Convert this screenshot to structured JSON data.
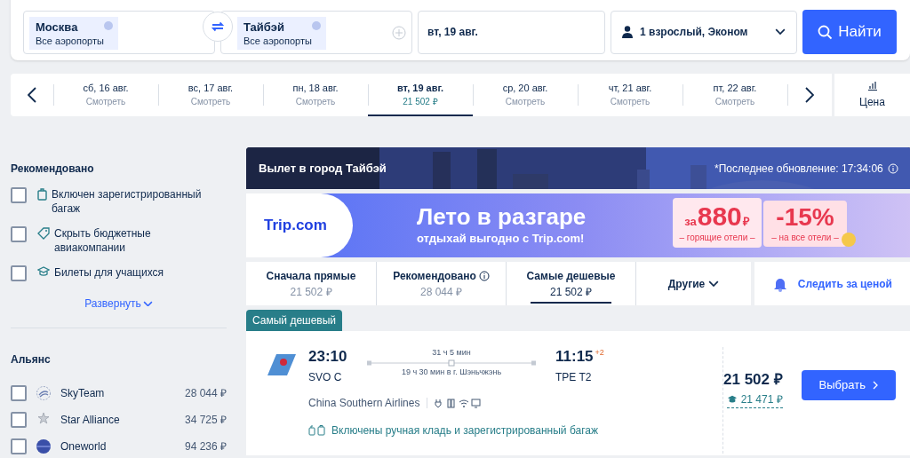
{
  "search": {
    "origin": {
      "city": "Москва",
      "airports": "Все аэропорты"
    },
    "destination": {
      "city": "Тайбэй",
      "airports": "Все аэропорты"
    },
    "date": "вт, 19 авг.",
    "passengers": "1 взрослый, Эконом",
    "button": "Найти"
  },
  "dates": [
    {
      "day": "сб, 16 авг.",
      "price": "Смотреть",
      "selected": false
    },
    {
      "day": "вс, 17 авг.",
      "price": "Смотреть",
      "selected": false
    },
    {
      "day": "пн, 18 авг.",
      "price": "Смотреть",
      "selected": false
    },
    {
      "day": "вт, 19 авг.",
      "price": "21 502 ₽",
      "selected": true
    },
    {
      "day": "ср, 20 авг.",
      "price": "Смотреть",
      "selected": false
    },
    {
      "day": "чт, 21 авг.",
      "price": "Смотреть",
      "selected": false
    },
    {
      "day": "пт, 22 авг.",
      "price": "Смотреть",
      "selected": false
    }
  ],
  "price_chart_button": "Цена",
  "sidebar": {
    "recommended": {
      "title": "Рекомендовано",
      "items": [
        {
          "kind": "baggage",
          "label": "Включен зарегистрированный багаж",
          "checked": false
        },
        {
          "kind": "tag",
          "label": "Скрыть бюджетные авиакомпании",
          "checked": false
        },
        {
          "kind": "student",
          "label": "Билеты для учащихся",
          "checked": false
        }
      ],
      "expand": "Развернуть"
    },
    "alliance": {
      "title": "Альянс",
      "items": [
        {
          "kind": "skyteam",
          "label": "SkyTeam",
          "price": "28 044 ₽",
          "checked": false
        },
        {
          "kind": "star",
          "label": "Star Alliance",
          "price": "34 725 ₽",
          "checked": false
        },
        {
          "kind": "oneworld",
          "label": "Oneworld",
          "price": "94 236 ₽",
          "checked": false
        }
      ]
    }
  },
  "header": {
    "title": "Вылет в город Тайбэй",
    "updated": "*Последнее обновление: 17:34:06"
  },
  "banner": {
    "brand": "Trip.com",
    "headline": "Лето в разгаре",
    "subline": "отдыхай выгодно с Trip.com!",
    "offer1_prefix": "за",
    "offer1_value": "880",
    "offer1_currency": "₽",
    "offer1_caption": "– горящие отели –",
    "offer2_value": "-15%",
    "offer2_caption": "– на все отели –"
  },
  "sort_tabs": [
    {
      "label": "Сначала прямые",
      "price": "21 502 ₽",
      "info": false,
      "selected": false
    },
    {
      "label": "Рекомендовано",
      "price": "28 044 ₽",
      "info": true,
      "selected": false
    },
    {
      "label": "Самые дешевые",
      "price": "21 502 ₽",
      "info": false,
      "selected": true
    }
  ],
  "more_sort": "Другие",
  "watch_price": "Следить за ценой",
  "flight": {
    "badge": "Самый дешевый",
    "depart_time": "23:10",
    "depart_airport": "SVO C",
    "duration": "31 ч 5 мин",
    "layover": "19 ч 30 мин в г. Шэньчжэнь",
    "arrive_time": "11:15",
    "day_offset": "+2",
    "arrive_airport": "TPE T2",
    "airline": "China Southern Airlines",
    "baggage": "Включены ручная кладь и зарегистрированный багаж",
    "price": "21 502 ₽",
    "student_price": "21 471 ₽",
    "select": "Выбрать"
  }
}
